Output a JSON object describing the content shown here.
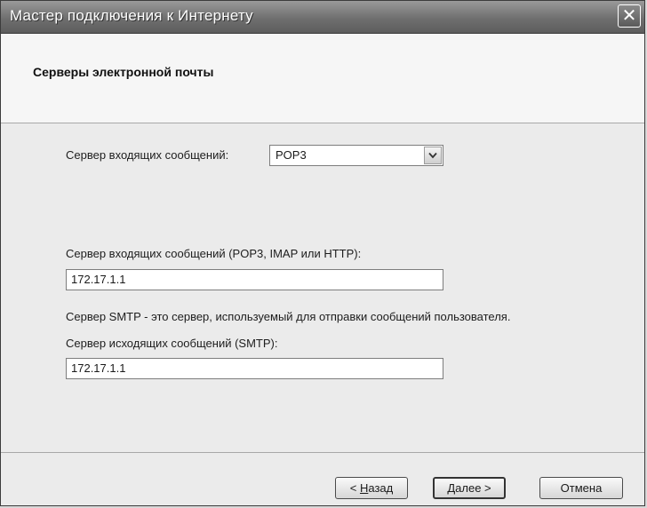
{
  "window": {
    "title": "Мастер подключения к Интернету",
    "close_icon": "close-icon"
  },
  "header": {
    "title": "Серверы электронной почты"
  },
  "form": {
    "incoming_type_label": "Сервер входящих сообщений:",
    "incoming_type_value": "POP3",
    "incoming_server_label": "Сервер входящих сообщений (POP3, IMAP или HTTP):",
    "incoming_server_value": "172.17.1.1",
    "smtp_note": "Сервер SMTP - это сервер, используемый для отправки сообщений  пользователя.",
    "outgoing_server_label": "Сервер исходящих сообщений (SMTP):",
    "outgoing_server_value": "172.17.1.1"
  },
  "buttons": {
    "back_prefix": "< ",
    "back_hotkey": "Н",
    "back_rest": "азад",
    "next_hotkey": "Д",
    "next_rest": "алее",
    "next_suffix": " >",
    "cancel": "Отмена"
  }
}
